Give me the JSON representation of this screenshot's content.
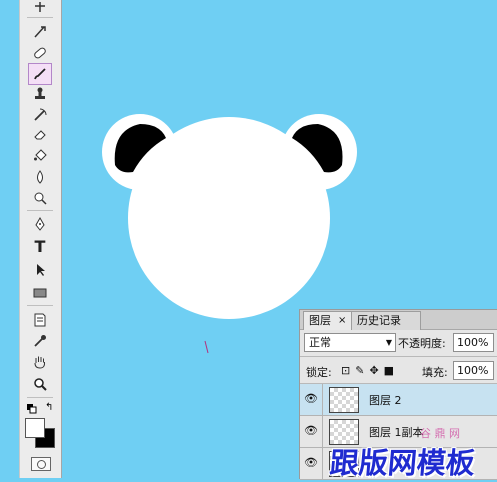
{
  "colors": {
    "canvas_bg": "#6fcff3",
    "head": "#ffffff",
    "ear_inner": "#000000",
    "stroke_mark": "#b03580"
  },
  "toolbar": {
    "tools": [
      {
        "name": "slice-tool-icon"
      },
      {
        "name": "healing-brush-icon"
      },
      {
        "name": "brush-tool-icon",
        "active": true
      },
      {
        "name": "clone-stamp-icon"
      },
      {
        "name": "history-brush-icon"
      },
      {
        "name": "eraser-icon"
      },
      {
        "name": "paint-bucket-icon"
      },
      {
        "name": "blur-tool-icon"
      },
      {
        "name": "dodge-tool-icon"
      },
      {
        "name": "pen-tool-icon"
      },
      {
        "name": "type-tool-icon",
        "glyph": "T"
      },
      {
        "name": "path-select-icon"
      },
      {
        "name": "rectangle-tool-icon"
      },
      {
        "name": "notes-tool-icon"
      },
      {
        "name": "eyedropper-icon"
      },
      {
        "name": "hand-tool-icon"
      },
      {
        "name": "zoom-tool-icon"
      }
    ]
  },
  "layers_panel": {
    "tab_layers": "图层",
    "tab_close": "×",
    "tab_history": "历史记录",
    "blend_mode": "正常",
    "opacity_label": "不透明度:",
    "opacity_value": "100%",
    "lock_label": "锁定:",
    "fill_label": "填充:",
    "fill_value": "100%",
    "layers": [
      {
        "name": "图层 2",
        "selected": true,
        "visible": true
      },
      {
        "name": "图层 1副本",
        "selected": false,
        "visible": true
      },
      {
        "name": "",
        "selected": false,
        "visible": true
      }
    ]
  },
  "watermark": {
    "text": "跟版网模板",
    "small": "谷 鼎 网"
  }
}
